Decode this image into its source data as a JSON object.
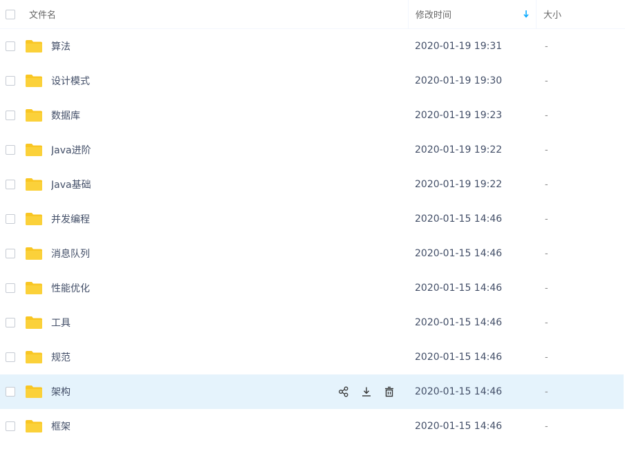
{
  "header": {
    "name_label": "文件名",
    "time_label": "修改时间",
    "size_label": "大小"
  },
  "files": [
    {
      "name": "算法",
      "time": "2020-01-19 19:31",
      "size": "-"
    },
    {
      "name": "设计模式",
      "time": "2020-01-19 19:30",
      "size": "-"
    },
    {
      "name": "数据库",
      "time": "2020-01-19 19:23",
      "size": "-"
    },
    {
      "name": "Java进阶",
      "time": "2020-01-19 19:22",
      "size": "-"
    },
    {
      "name": "Java基础",
      "time": "2020-01-19 19:22",
      "size": "-"
    },
    {
      "name": "并发编程",
      "time": "2020-01-15 14:46",
      "size": "-"
    },
    {
      "name": "消息队列",
      "time": "2020-01-15 14:46",
      "size": "-"
    },
    {
      "name": "性能优化",
      "time": "2020-01-15 14:46",
      "size": "-"
    },
    {
      "name": "工具",
      "time": "2020-01-15 14:46",
      "size": "-"
    },
    {
      "name": "规范",
      "time": "2020-01-15 14:46",
      "size": "-"
    },
    {
      "name": "架构",
      "time": "2020-01-15 14:46",
      "size": "-"
    },
    {
      "name": "框架",
      "time": "2020-01-15 14:46",
      "size": "-"
    }
  ],
  "hover_row_index": 10,
  "icons": {
    "folder": "folder-icon",
    "share": "share-icon",
    "download": "download-icon",
    "delete": "trash-icon",
    "sort": "sort-down-arrow-icon"
  },
  "colors": {
    "folder": "#f9c623",
    "hover_bg": "#e5f3fc",
    "sort_arrow": "#09aaff",
    "text": "#424e67"
  }
}
